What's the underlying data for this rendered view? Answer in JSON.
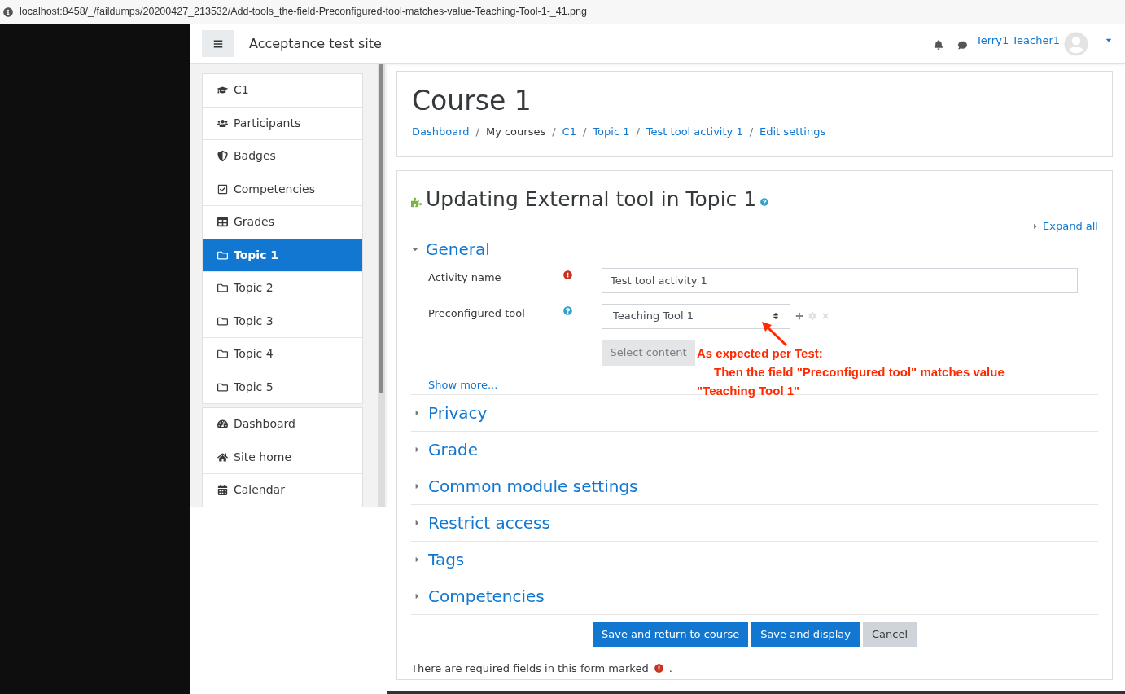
{
  "url_bar": {
    "url": "localhost:8458/_/faildumps/20200427_213532/Add-tools_the-field-Preconfigured-tool-matches-value-Teaching-Tool-1-_41.png"
  },
  "navbar": {
    "site_name": "Acceptance test site",
    "user_name": "Terry1 Teacher1"
  },
  "sidebar": {
    "groups": [
      {
        "items": [
          {
            "label": "C1",
            "kind": "course",
            "selected": false
          },
          {
            "label": "Participants",
            "kind": "users",
            "selected": false
          },
          {
            "label": "Badges",
            "kind": "shield",
            "selected": false
          },
          {
            "label": "Competencies",
            "kind": "check",
            "selected": false
          },
          {
            "label": "Grades",
            "kind": "table",
            "selected": false
          },
          {
            "label": "Topic 1",
            "kind": "folder",
            "selected": true
          },
          {
            "label": "Topic 2",
            "kind": "folder",
            "selected": false
          },
          {
            "label": "Topic 3",
            "kind": "folder",
            "selected": false
          },
          {
            "label": "Topic 4",
            "kind": "folder",
            "selected": false
          },
          {
            "label": "Topic 5",
            "kind": "folder",
            "selected": false
          }
        ]
      },
      {
        "items": [
          {
            "label": "Dashboard",
            "kind": "dashboard",
            "selected": false
          },
          {
            "label": "Site home",
            "kind": "home",
            "selected": false
          },
          {
            "label": "Calendar",
            "kind": "calendar",
            "selected": false
          }
        ]
      }
    ]
  },
  "course": {
    "title": "Course 1",
    "breadcrumb_separator": "/",
    "breadcrumb": [
      {
        "label": "Dashboard",
        "kind": "link"
      },
      {
        "label": "My courses",
        "kind": "text"
      },
      {
        "label": "C1",
        "kind": "link"
      },
      {
        "label": "Topic 1",
        "kind": "link"
      },
      {
        "label": "Test tool activity 1",
        "kind": "link"
      },
      {
        "label": "Edit settings",
        "kind": "link"
      }
    ]
  },
  "form": {
    "heading": "Updating External tool in Topic 1",
    "expand_all": "Expand all",
    "general": {
      "title": "General",
      "expanded": true,
      "activity_name": {
        "label": "Activity name",
        "required": true,
        "value": "Test tool activity 1"
      },
      "preconfigured_tool": {
        "label": "Preconfigured tool",
        "value": "Teaching Tool 1"
      },
      "select_content": {
        "label": "Select content",
        "disabled": true
      },
      "show_more": "Show more..."
    },
    "sections": [
      {
        "title": "Privacy",
        "expanded": false
      },
      {
        "title": "Grade",
        "expanded": false
      },
      {
        "title": "Common module settings",
        "expanded": false
      },
      {
        "title": "Restrict access",
        "expanded": false
      },
      {
        "title": "Tags",
        "expanded": false
      },
      {
        "title": "Competencies",
        "expanded": false
      }
    ],
    "buttons": [
      {
        "label": "Save and return to course",
        "kind": "primary"
      },
      {
        "label": "Save and display",
        "kind": "primary"
      },
      {
        "label": "Cancel",
        "kind": "secondary"
      }
    ],
    "required_note": {
      "text": "There are required fields in this form marked",
      "end": "."
    }
  },
  "annotation": {
    "lines": [
      "As expected per Test:",
      "Then the field \"Preconfigured tool\" matches value",
      "\"Teaching Tool 1\""
    ]
  }
}
